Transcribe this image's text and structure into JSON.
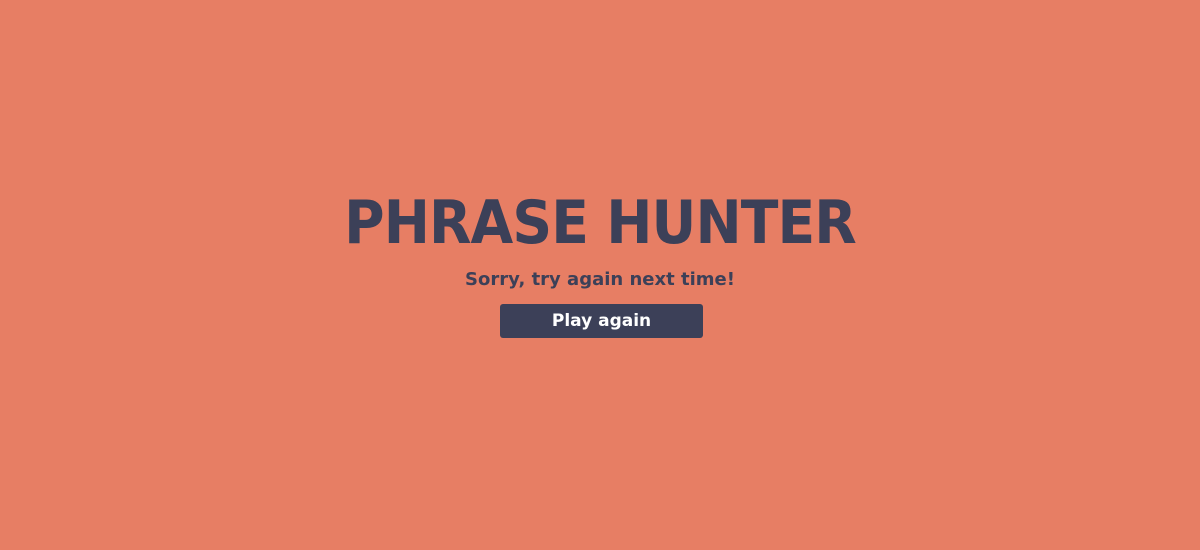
{
  "game": {
    "title": "PHRASE HUNTER",
    "message": "Sorry, try again next time!",
    "play_again_label": "Play again"
  },
  "colors": {
    "background": "#e77e64",
    "text": "#3c4058",
    "button_background": "#3c4058",
    "button_text": "#ffffff"
  }
}
